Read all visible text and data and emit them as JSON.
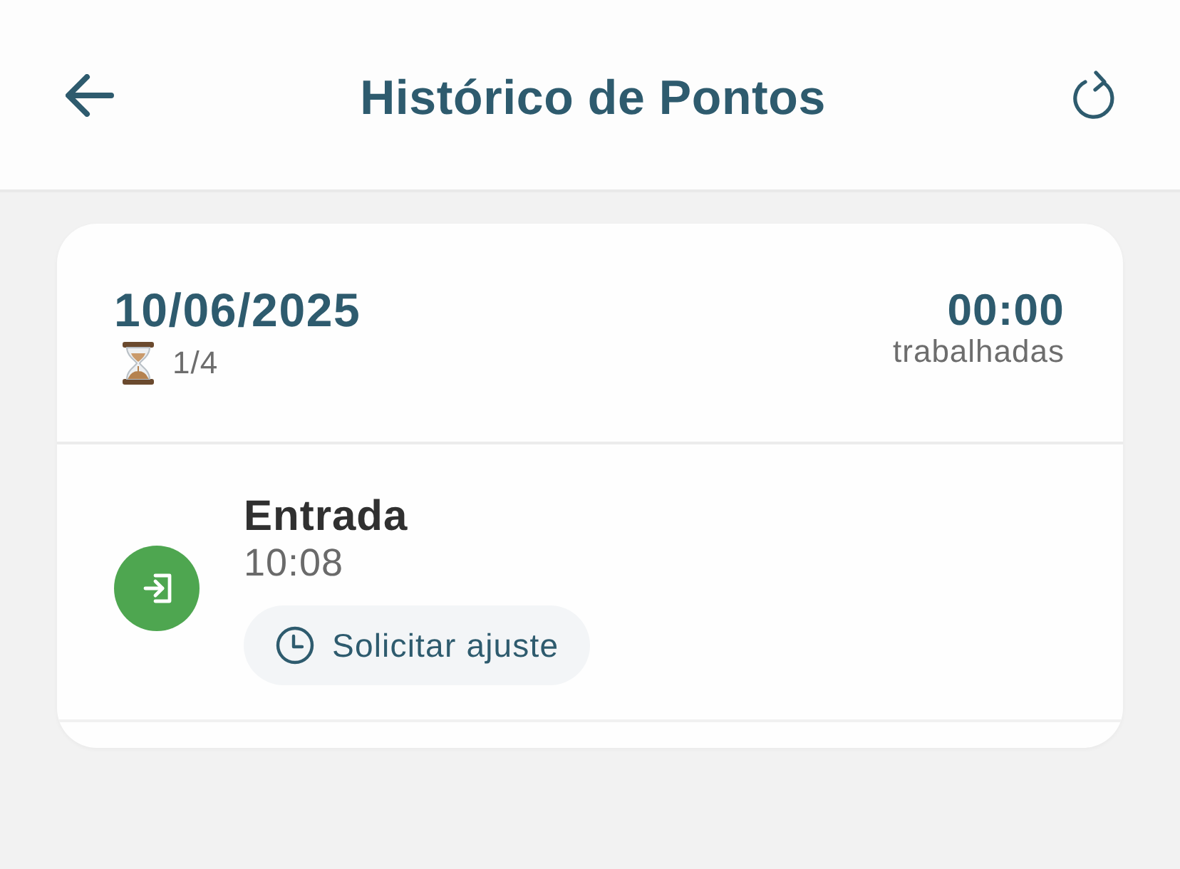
{
  "header": {
    "title": "Histórico de Pontos"
  },
  "day": {
    "date": "10/06/2025",
    "punches": "1/4",
    "worked_time": "00:00",
    "worked_label": "trabalhadas"
  },
  "entries": [
    {
      "kind": "entrada",
      "label": "Entrada",
      "time": "10:08",
      "action": "Solicitar ajuste"
    }
  ]
}
